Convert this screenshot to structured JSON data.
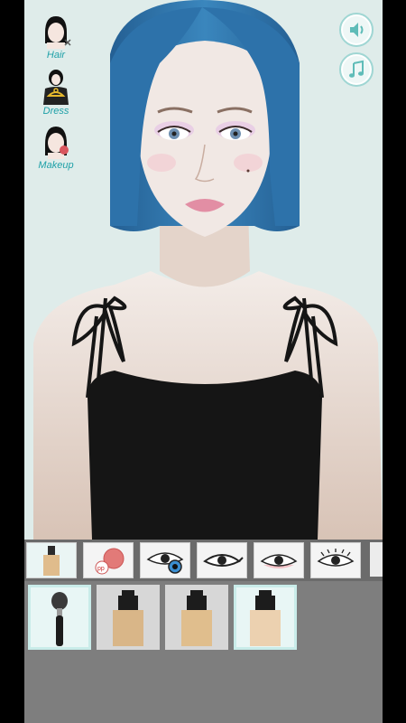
{
  "menu": {
    "hair_label": "Hair",
    "dress_label": "Dress",
    "makeup_label": "Makeup"
  },
  "controls": {
    "sound_icon": "speaker-icon",
    "music_icon": "music-note-icon"
  },
  "colors": {
    "hair": "#2f78b0",
    "accent": "#1fa1a8",
    "panel": "#7e7e7e",
    "dress": "#151515"
  },
  "makeup_tabs": [
    {
      "icon": "foundation-bottle-icon",
      "active": true
    },
    {
      "icon": "blush-compact-icon",
      "active": false
    },
    {
      "icon": "eye-color-icon",
      "active": false
    },
    {
      "icon": "eyeliner-icon",
      "active": false
    },
    {
      "icon": "eyeshadow-icon",
      "active": false
    },
    {
      "icon": "eyelashes-icon",
      "active": false
    }
  ],
  "items": [
    {
      "icon": "makeup-brush-icon",
      "selected": true
    },
    {
      "icon": "foundation-bottle-icon",
      "shade": "#d9b688",
      "selected": false
    },
    {
      "icon": "foundation-bottle-icon",
      "shade": "#e0be8d",
      "selected": false
    },
    {
      "icon": "foundation-bottle-icon",
      "shade": "#ecd1b0",
      "selected": true
    }
  ]
}
